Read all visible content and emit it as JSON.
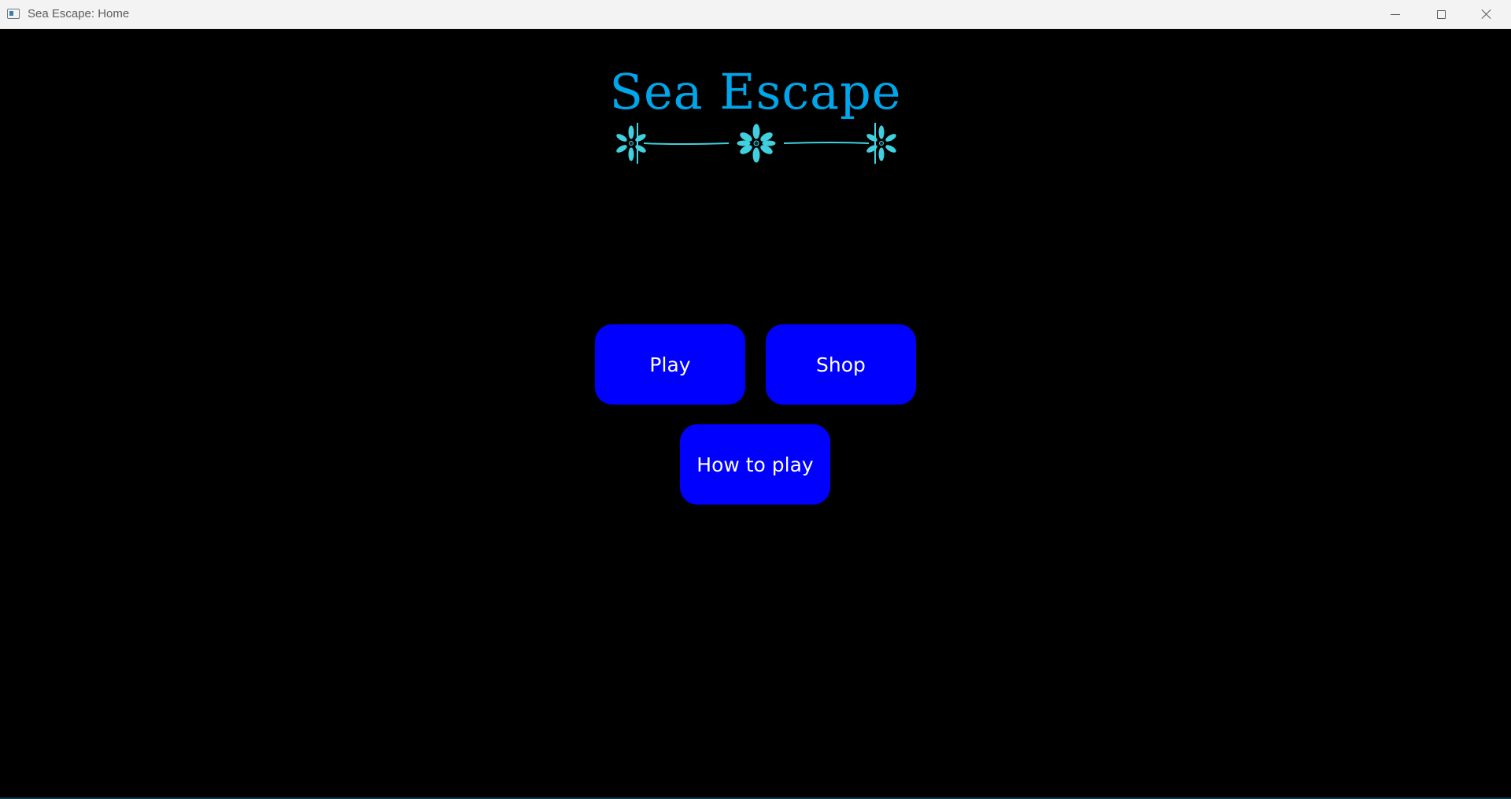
{
  "window": {
    "title": "Sea Escape: Home",
    "icons": {
      "app": "app-window-icon",
      "minimize": "minimize-icon",
      "maximize": "maximize-icon",
      "close": "close-icon"
    }
  },
  "game": {
    "title": "Sea Escape",
    "ornament": "floral-divider-ornament",
    "colors": {
      "background": "#000000",
      "title": "#00a6ea",
      "ornament": "#40d0e0",
      "button_bg": "#0000ff",
      "button_text": "#ffffff"
    }
  },
  "menu": {
    "play_label": "Play",
    "shop_label": "Shop",
    "howto_label": "How to play"
  }
}
